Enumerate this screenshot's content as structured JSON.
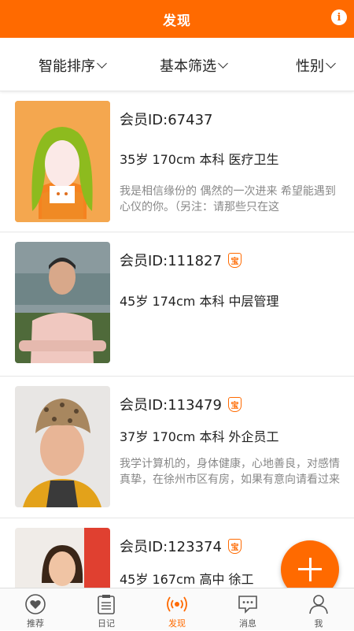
{
  "header": {
    "title": "发现",
    "info_icon": "i"
  },
  "filters": [
    {
      "label": "智能排序"
    },
    {
      "label": "基本筛选"
    },
    {
      "label": "性别"
    }
  ],
  "members": [
    {
      "id_label": "会员ID:67437",
      "stats": "35岁 170cm 本科 医疗卫生",
      "desc": "我是相信缘份的 偶然的一次进来 希望能遇到心仪的你。（另注：请那些只在这",
      "vip": false
    },
    {
      "id_label": "会员ID:111827",
      "stats": "45岁 174cm 本科 中层管理",
      "desc": "",
      "vip": true
    },
    {
      "id_label": "会员ID:113479",
      "stats": "37岁 170cm 本科 外企员工",
      "desc": "我学计算机的，身体健康，心地善良，对感情真挚，在徐州市区有房，如果有意向请看过来",
      "vip": true
    },
    {
      "id_label": "会员ID:123374",
      "stats": "45岁 167cm 高中 徐工",
      "desc": "",
      "vip": true
    }
  ],
  "vip_badge": "宝",
  "tabbar": [
    {
      "label": "推荐",
      "icon": "heart-icon"
    },
    {
      "label": "日记",
      "icon": "notepad-icon"
    },
    {
      "label": "发现",
      "icon": "broadcast-icon",
      "active": true
    },
    {
      "label": "消息",
      "icon": "chat-icon"
    },
    {
      "label": "我",
      "icon": "person-icon"
    }
  ],
  "colors": {
    "accent": "#ff6a00"
  }
}
